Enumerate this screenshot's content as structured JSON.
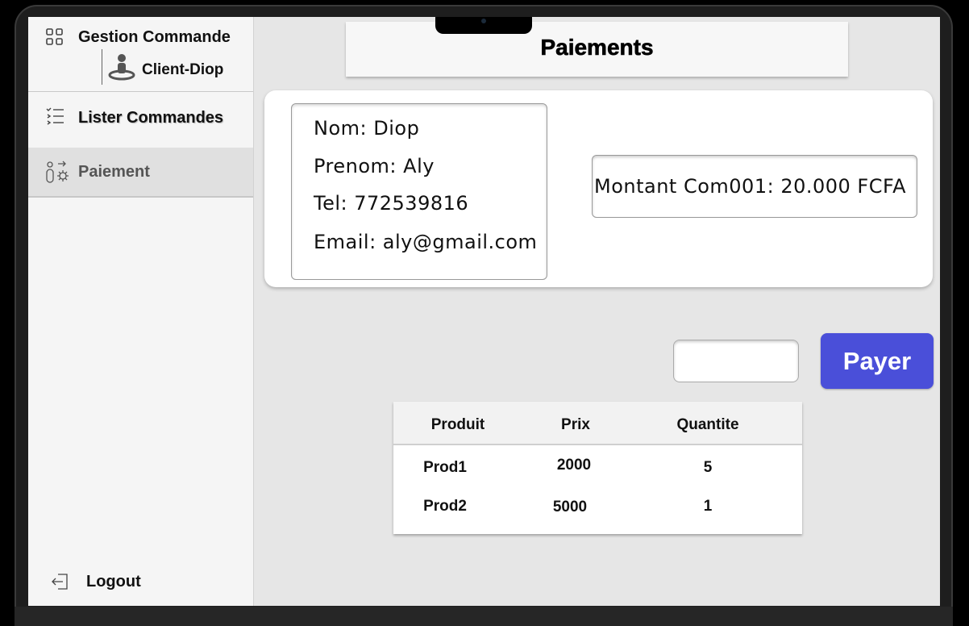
{
  "sidebar": {
    "app_title": "Gestion Commande",
    "client_name": "Client-Diop",
    "items": [
      {
        "label": "Lister Commandes",
        "icon": "list-icon"
      },
      {
        "label": "Paiement",
        "icon": "payment-icon",
        "active": true
      }
    ],
    "logout_label": "Logout"
  },
  "header": {
    "title": "Paiements"
  },
  "client": {
    "nom": "Nom: Diop",
    "prenom": "Prenom: Aly",
    "tel": "Tel: 772539816",
    "email": "Email: aly@gmail.com"
  },
  "montant": "Montant Com001: 20.000 FCFA",
  "payment": {
    "input_value": "",
    "button_label": "Payer"
  },
  "table": {
    "columns": [
      "Produit",
      "Prix",
      "Quantite"
    ],
    "rows": [
      [
        "Prod1",
        "2000",
        "5"
      ],
      [
        "Prod2",
        "5000",
        "1"
      ]
    ]
  },
  "colors": {
    "accent": "#4a4fd9",
    "sidebar_bg": "#f5f5f5",
    "content_bg": "#e6e6e6"
  }
}
